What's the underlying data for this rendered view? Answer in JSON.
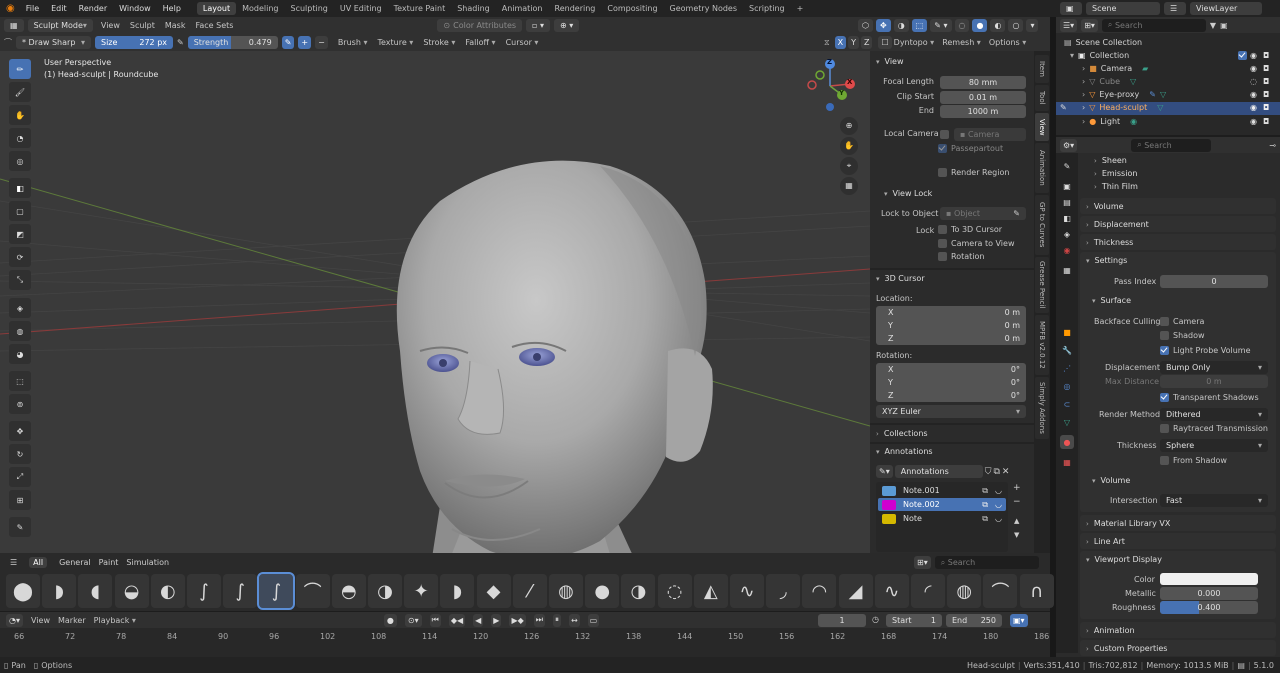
{
  "menu": {
    "items": [
      "File",
      "Edit",
      "Render",
      "Window",
      "Help"
    ],
    "workspaces": [
      "Layout",
      "Modeling",
      "Sculpting",
      "UV Editing",
      "Texture Paint",
      "Shading",
      "Animation",
      "Rendering",
      "Compositing",
      "Geometry Nodes",
      "Scripting",
      "+"
    ],
    "scene_label": "Scene",
    "viewlayer_label": "ViewLayer"
  },
  "header": {
    "mode": "Sculpt Mode",
    "view": "View",
    "sculpt": "Sculpt",
    "mask": "Mask",
    "face_sets": "Face Sets",
    "color_attributes": "Color Attributes"
  },
  "toolsettings": {
    "brush_name": "* Draw Sharp",
    "size_label": "Size",
    "size_value": "272 px",
    "strength_label": "Strength",
    "strength_value": "0.479",
    "strength_fraction": 0.479,
    "brush": "Brush",
    "texture": "Texture",
    "stroke": "Stroke",
    "falloff": "Falloff",
    "cursor": "Cursor",
    "x": "X",
    "y": "Y",
    "z": "Z",
    "dyntopo": "Dyntopo",
    "remesh": "Remesh",
    "options": "Options"
  },
  "viewport": {
    "perspective": "User Perspective",
    "object_info": "(1) Head-sculpt | Roundcube",
    "gizmo": {
      "x": "X",
      "y": "Y",
      "z": "Z"
    }
  },
  "npanel": {
    "view_header": "View",
    "focal_length_label": "Focal Length",
    "focal_length": "80 mm",
    "clip_start_label": "Clip Start",
    "clip_start": "0.01 m",
    "end_label": "End",
    "end": "1000 m",
    "local_camera_label": "Local Camera",
    "camera_placeholder": "Camera",
    "passepartout": "Passepartout",
    "render_region": "Render Region",
    "view_lock_header": "View Lock",
    "lock_to_object_label": "Lock to Object",
    "object_placeholder": "Object",
    "lock_label": "Lock",
    "to_3d_cursor": "To 3D Cursor",
    "camera_to_view": "Camera to View",
    "rotation_check": "Rotation",
    "cursor_header": "3D Cursor",
    "location_label": "Location:",
    "loc_x": "0 m",
    "loc_y": "0 m",
    "loc_z": "0 m",
    "rotation_label": "Rotation:",
    "rot_x": "0°",
    "rot_y": "0°",
    "rot_z": "0°",
    "axis_x": "X",
    "axis_y": "Y",
    "axis_z": "Z",
    "rotation_mode": "XYZ Euler",
    "collections_header": "Collections",
    "annotations_header": "Annotations",
    "annotations_name": "Annotations",
    "notes": [
      {
        "name": "Note.001",
        "color": "#5b9bd5"
      },
      {
        "name": "Note.002",
        "color": "#d000d0"
      },
      {
        "name": "Note",
        "color": "#d4b800"
      }
    ]
  },
  "vtabs": [
    "Item",
    "Tool",
    "View",
    "Animation",
    "GP to Curves",
    "Grease Pencil",
    "MPFB v2.0.12",
    "Simply Addons"
  ],
  "outliner": {
    "search_placeholder": "Search",
    "scene_collection": "Scene Collection",
    "collection": "Collection",
    "objects": [
      {
        "name": "Camera",
        "color": "#d48a3a"
      },
      {
        "name": "Cube",
        "color": "#888888"
      },
      {
        "name": "Eye-proxy",
        "color": "#dcdcdc"
      },
      {
        "name": "Head-sculpt",
        "color": "#ff9a3a"
      },
      {
        "name": "Light",
        "color": "#dcdcdc"
      }
    ]
  },
  "properties": {
    "search_placeholder": "Search",
    "sheen": "Sheen",
    "emission": "Emission",
    "thin_film": "Thin Film",
    "volume": "Volume",
    "displacement": "Displacement",
    "thickness": "Thickness",
    "settings": "Settings",
    "pass_index_label": "Pass Index",
    "pass_index": "0",
    "surface": "Surface",
    "backface_culling_label": "Backface Culling",
    "bc_camera": "Camera",
    "bc_shadow": "Shadow",
    "bc_light_probe": "Light Probe Volume",
    "displacement_label": "Displacement",
    "displacement_value": "Bump Only",
    "max_distance_label": "Max Distance",
    "max_distance": "0 m",
    "transparent_shadows": "Transparent Shadows",
    "render_method_label": "Render Method",
    "render_method": "Dithered",
    "raytraced_transmission": "Raytraced Transmission",
    "thickness_label": "Thickness",
    "thickness_value": "Sphere",
    "from_shadow": "From Shadow",
    "volume2": "Volume",
    "intersection_label": "Intersection",
    "intersection_value": "Fast",
    "material_library": "Material Library VX",
    "line_art": "Line Art",
    "viewport_display": "Viewport Display",
    "color_label": "Color",
    "metallic_label": "Metallic",
    "metallic": "0.000",
    "roughness_label": "Roughness",
    "roughness": "0.400",
    "roughness_fraction": 0.4,
    "animation": "Animation",
    "custom_properties": "Custom Properties"
  },
  "shelf": {
    "tabs": [
      "All",
      "General",
      "Paint",
      "Simulation"
    ],
    "search_placeholder": "Search"
  },
  "timeline": {
    "view": "View",
    "marker": "Marker",
    "playback": "Playback",
    "current_frame": "1",
    "start_label": "Start",
    "start": "1",
    "end_label": "End",
    "end": "250",
    "ticks": [
      "66",
      "72",
      "78",
      "84",
      "90",
      "96",
      "102",
      "108",
      "114",
      "120",
      "126",
      "132",
      "138",
      "144",
      "150",
      "156",
      "162",
      "168",
      "174",
      "180",
      "186"
    ]
  },
  "status": {
    "pan": "Pan",
    "options": "Options",
    "object": "Head-sculpt",
    "verts": "Verts:351,410",
    "tris": "Tris:702,812",
    "memory": "Memory: 1013.5 MiB",
    "version": "5.1.0"
  }
}
